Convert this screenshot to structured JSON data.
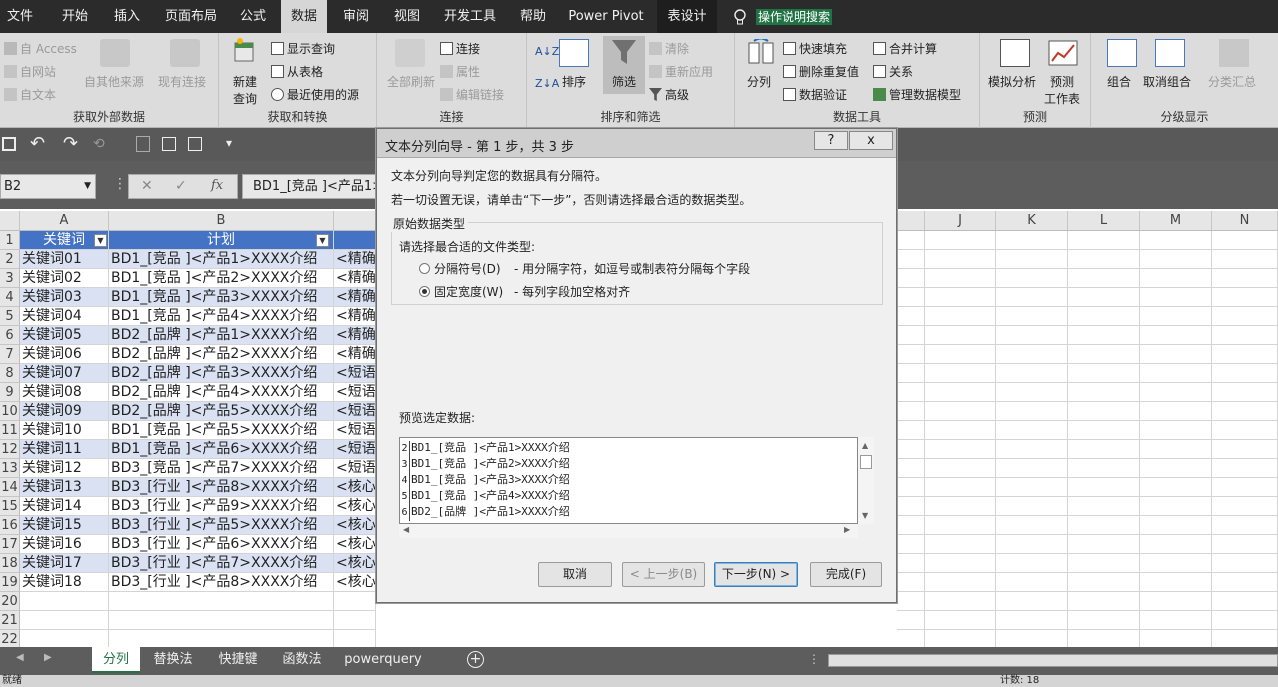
{
  "menu": {
    "tabs": [
      "文件",
      "开始",
      "插入",
      "页面布局",
      "公式",
      "数据",
      "审阅",
      "视图",
      "开发工具",
      "帮助",
      "Power Pivot",
      "表设计"
    ],
    "active": "数据",
    "tell_me": "操作说明搜索"
  },
  "ribbon": {
    "get_external": {
      "access": "自 Access",
      "web": "自网站",
      "text": "自文本",
      "other": "自其他来源",
      "existing": "现有连接",
      "label": "获取外部数据"
    },
    "get_transform": {
      "new_query": "新建",
      "new_query2": "查询",
      "show_queries": "显示查询",
      "from_table": "从表格",
      "recent": "最近使用的源",
      "label": "获取和转换"
    },
    "connections": {
      "refresh_all": "全部刷新",
      "conn": "连接",
      "props": "属性",
      "edit_links": "编辑链接",
      "label": "连接"
    },
    "sort_filter": {
      "sort": "排序",
      "filter": "筛选",
      "clear": "清除",
      "reapply": "重新应用",
      "advanced": "高级",
      "label": "排序和筛选"
    },
    "data_tools": {
      "split": "分列",
      "flash_fill": "快速填充",
      "remove_dup": "删除重复值",
      "validate": "数据验证",
      "consolidate": "合并计算",
      "relations": "关系",
      "model": "管理数据模型",
      "label": "数据工具"
    },
    "forecast": {
      "whatif": "模拟分析",
      "forecast_sheet": "预测",
      "forecast_sheet2": "工作表",
      "label": "预测"
    },
    "outline": {
      "group": "组合",
      "ungroup": "取消组合",
      "subtotal": "分类汇总",
      "label": "分级显示"
    }
  },
  "formula_bar": {
    "name_box": "B2",
    "content": "BD1_[竞品 ]<产品1>"
  },
  "columns": [
    "A",
    "B",
    "J",
    "K",
    "L",
    "M",
    "N"
  ],
  "header_row": {
    "a": "关键词",
    "b": "计划"
  },
  "rows": [
    {
      "a": "关键词01",
      "b": "BD1_[竞品 ]<产品1>XXXX介绍",
      "c": "<精确"
    },
    {
      "a": "关键词02",
      "b": "BD1_[竞品 ]<产品2>XXXX介绍",
      "c": "<精确"
    },
    {
      "a": "关键词03",
      "b": "BD1_[竞品 ]<产品3>XXXX介绍",
      "c": "<精确"
    },
    {
      "a": "关键词04",
      "b": "BD1_[竞品 ]<产品4>XXXX介绍",
      "c": "<精确"
    },
    {
      "a": "关键词05",
      "b": "BD2_[品牌 ]<产品1>XXXX介绍",
      "c": "<精确"
    },
    {
      "a": "关键词06",
      "b": "BD2_[品牌 ]<产品2>XXXX介绍",
      "c": "<精确"
    },
    {
      "a": "关键词07",
      "b": "BD2_[品牌 ]<产品3>XXXX介绍",
      "c": "<短语"
    },
    {
      "a": "关键词08",
      "b": "BD2_[品牌 ]<产品4>XXXX介绍",
      "c": "<短语"
    },
    {
      "a": "关键词09",
      "b": "BD2_[品牌 ]<产品5>XXXX介绍",
      "c": "<短语"
    },
    {
      "a": "关键词10",
      "b": "BD1_[竞品 ]<产品5>XXXX介绍",
      "c": "<短语"
    },
    {
      "a": "关键词11",
      "b": "BD1_[竞品 ]<产品6>XXXX介绍",
      "c": "<短语"
    },
    {
      "a": "关键词12",
      "b": "BD3_[竞品 ]<产品7>XXXX介绍",
      "c": "<短语"
    },
    {
      "a": "关键词13",
      "b": "BD3_[行业 ]<产品8>XXXX介绍",
      "c": "<核心"
    },
    {
      "a": "关键词14",
      "b": "BD3_[行业 ]<产品9>XXXX介绍",
      "c": "<核心"
    },
    {
      "a": "关键词15",
      "b": "BD3_[行业 ]<产品5>XXXX介绍",
      "c": "<核心"
    },
    {
      "a": "关键词16",
      "b": "BD3_[行业 ]<产品6>XXXX介绍",
      "c": "<核心"
    },
    {
      "a": "关键词17",
      "b": "BD3_[行业 ]<产品7>XXXX介绍",
      "c": "<核心"
    },
    {
      "a": "关键词18",
      "b": "BD3_[行业 ]<产品8>XXXX介绍",
      "c": "<核心"
    }
  ],
  "row_numbers": [
    "1",
    "2",
    "3",
    "4",
    "5",
    "6",
    "7",
    "8",
    "9",
    "10",
    "11",
    "12",
    "13",
    "14",
    "15",
    "16",
    "17",
    "18",
    "19",
    "20",
    "21",
    "22"
  ],
  "sheet_tabs": [
    "分列",
    "替换法",
    "快捷键",
    "函数法",
    "powerquery"
  ],
  "active_sheet": "分列",
  "status": {
    "left": "就绪",
    "count": "计数: 18"
  },
  "dialog": {
    "title": "文本分列向导 - 第 1 步，共 3 步",
    "help": "?",
    "close": "x",
    "line1": "文本分列向导判定您的数据具有分隔符。",
    "line2": "若一切设置无误，请单击“下一步”，否则请选择最合适的数据类型。",
    "group_label": "原始数据类型",
    "choose": "请选择最合适的文件类型:",
    "opt1": "分隔符号(D)",
    "opt1_desc": "- 用分隔字符，如逗号或制表符分隔每个字段",
    "opt2": "固定宽度(W)",
    "opt2_desc": "- 每列字段加空格对齐",
    "selected": "固定宽度(W)",
    "preview_label": "预览选定数据:",
    "preview": [
      {
        "n": "2",
        "t": "BD1_[竞品 ]<产品1>XXXX介绍"
      },
      {
        "n": "3",
        "t": "BD1_[竞品 ]<产品2>XXXX介绍"
      },
      {
        "n": "4",
        "t": "BD1_[竞品 ]<产品3>XXXX介绍"
      },
      {
        "n": "5",
        "t": "BD1_[竞品 ]<产品4>XXXX介绍"
      },
      {
        "n": "6",
        "t": "BD2_[品牌 ]<产品1>XXXX介绍"
      }
    ],
    "buttons": {
      "cancel": "取消",
      "back": "< 上一步(B)",
      "next": "下一步(N) >",
      "finish": "完成(F)"
    }
  },
  "colors": {
    "accent": "#217346",
    "table_header": "#4472c4",
    "band": "#d9e1f2"
  }
}
